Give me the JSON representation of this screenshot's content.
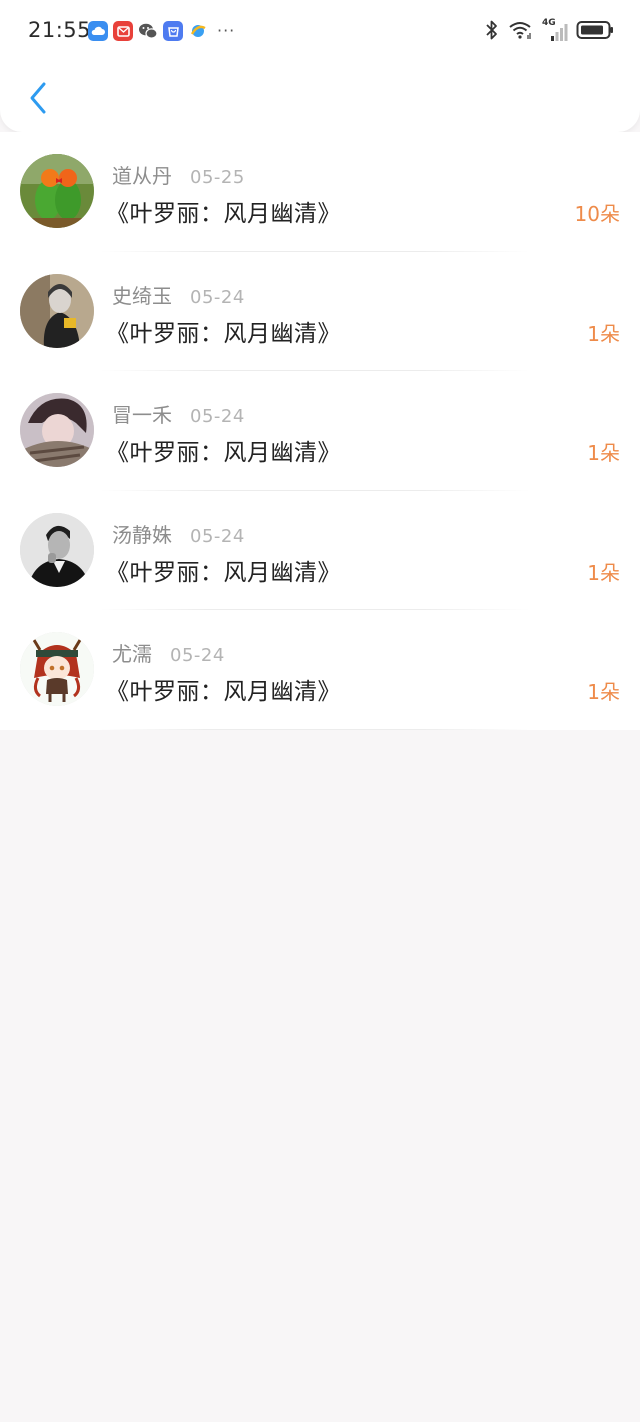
{
  "statusbar": {
    "time": "21:55",
    "apps": [
      "cloud-icon",
      "mail-icon",
      "wechat-icon",
      "store-icon",
      "browser-icon"
    ],
    "more": "···",
    "network": "4G"
  },
  "nav": {
    "back": "back-chevron-icon"
  },
  "colors": {
    "accent": "#2d9bf0",
    "count": "#ee8b4a",
    "name": "#8d8d8d",
    "date": "#b4b4b4"
  },
  "rows": [
    {
      "name": "道从丹",
      "date": "05-25",
      "title": "《叶罗丽：风月幽清》",
      "count": "10朵",
      "avatar": "parrots-avatar"
    },
    {
      "name": "史绮玉",
      "date": "05-24",
      "title": "《叶罗丽：风月幽清》",
      "count": "1朵",
      "avatar": "hooded-person-avatar"
    },
    {
      "name": "冒一禾",
      "date": "05-24",
      "title": "《叶罗丽：风月幽清》",
      "count": "1朵",
      "avatar": "scarf-person-avatar"
    },
    {
      "name": "汤静姝",
      "date": "05-24",
      "title": "《叶罗丽：风月幽清》",
      "count": "1朵",
      "avatar": "bw-man-avatar"
    },
    {
      "name": "尤濡",
      "date": "05-24",
      "title": "《叶罗丽：风月幽清》",
      "count": "1朵",
      "avatar": "chibi-character-avatar"
    }
  ]
}
